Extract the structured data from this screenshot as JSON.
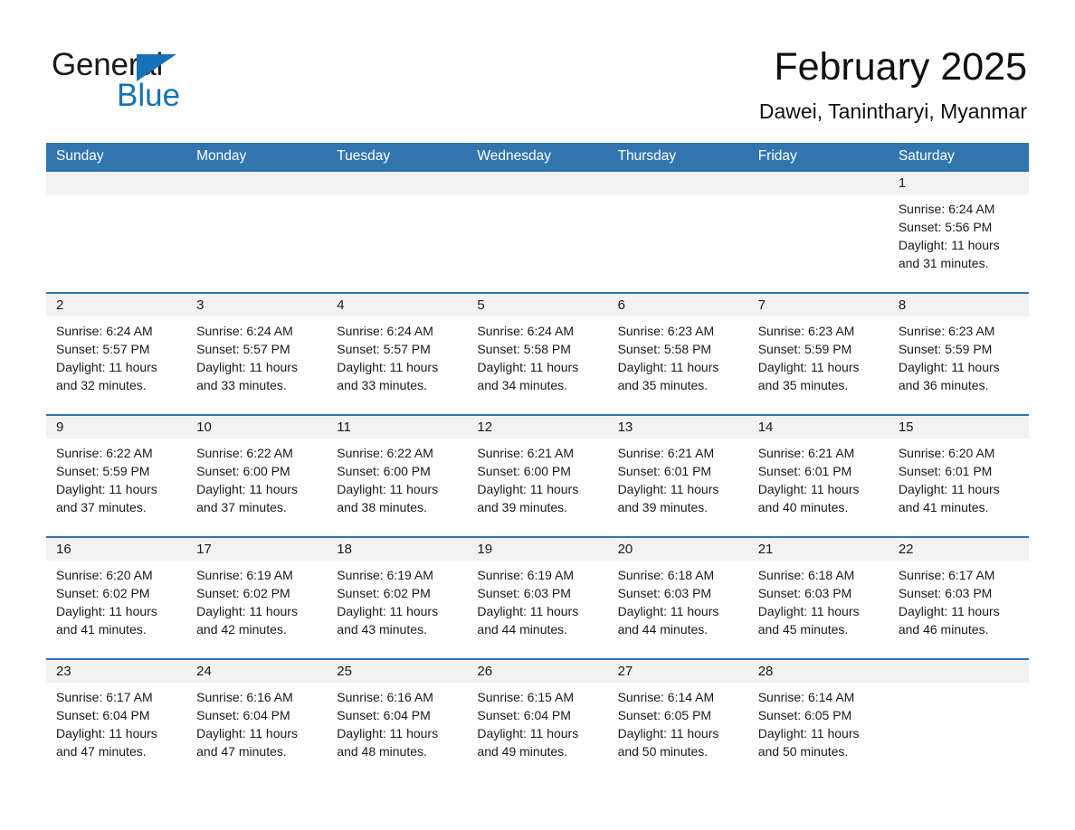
{
  "brand": {
    "name_part1": "General",
    "name_part2": "Blue",
    "triangle_color": "#1672b8"
  },
  "header": {
    "title": "February 2025",
    "subtitle": "Dawei, Tanintharyi, Myanmar",
    "accent_color": "#3175b0"
  },
  "weekday_headers": [
    "Sunday",
    "Monday",
    "Tuesday",
    "Wednesday",
    "Thursday",
    "Friday",
    "Saturday"
  ],
  "weeks": [
    [
      {
        "day": "",
        "sunrise": "",
        "sunset": "",
        "daylight": ""
      },
      {
        "day": "",
        "sunrise": "",
        "sunset": "",
        "daylight": ""
      },
      {
        "day": "",
        "sunrise": "",
        "sunset": "",
        "daylight": ""
      },
      {
        "day": "",
        "sunrise": "",
        "sunset": "",
        "daylight": ""
      },
      {
        "day": "",
        "sunrise": "",
        "sunset": "",
        "daylight": ""
      },
      {
        "day": "",
        "sunrise": "",
        "sunset": "",
        "daylight": ""
      },
      {
        "day": "1",
        "sunrise": "Sunrise: 6:24 AM",
        "sunset": "Sunset: 5:56 PM",
        "daylight": "Daylight: 11 hours and 31 minutes."
      }
    ],
    [
      {
        "day": "2",
        "sunrise": "Sunrise: 6:24 AM",
        "sunset": "Sunset: 5:57 PM",
        "daylight": "Daylight: 11 hours and 32 minutes."
      },
      {
        "day": "3",
        "sunrise": "Sunrise: 6:24 AM",
        "sunset": "Sunset: 5:57 PM",
        "daylight": "Daylight: 11 hours and 33 minutes."
      },
      {
        "day": "4",
        "sunrise": "Sunrise: 6:24 AM",
        "sunset": "Sunset: 5:57 PM",
        "daylight": "Daylight: 11 hours and 33 minutes."
      },
      {
        "day": "5",
        "sunrise": "Sunrise: 6:24 AM",
        "sunset": "Sunset: 5:58 PM",
        "daylight": "Daylight: 11 hours and 34 minutes."
      },
      {
        "day": "6",
        "sunrise": "Sunrise: 6:23 AM",
        "sunset": "Sunset: 5:58 PM",
        "daylight": "Daylight: 11 hours and 35 minutes."
      },
      {
        "day": "7",
        "sunrise": "Sunrise: 6:23 AM",
        "sunset": "Sunset: 5:59 PM",
        "daylight": "Daylight: 11 hours and 35 minutes."
      },
      {
        "day": "8",
        "sunrise": "Sunrise: 6:23 AM",
        "sunset": "Sunset: 5:59 PM",
        "daylight": "Daylight: 11 hours and 36 minutes."
      }
    ],
    [
      {
        "day": "9",
        "sunrise": "Sunrise: 6:22 AM",
        "sunset": "Sunset: 5:59 PM",
        "daylight": "Daylight: 11 hours and 37 minutes."
      },
      {
        "day": "10",
        "sunrise": "Sunrise: 6:22 AM",
        "sunset": "Sunset: 6:00 PM",
        "daylight": "Daylight: 11 hours and 37 minutes."
      },
      {
        "day": "11",
        "sunrise": "Sunrise: 6:22 AM",
        "sunset": "Sunset: 6:00 PM",
        "daylight": "Daylight: 11 hours and 38 minutes."
      },
      {
        "day": "12",
        "sunrise": "Sunrise: 6:21 AM",
        "sunset": "Sunset: 6:00 PM",
        "daylight": "Daylight: 11 hours and 39 minutes."
      },
      {
        "day": "13",
        "sunrise": "Sunrise: 6:21 AM",
        "sunset": "Sunset: 6:01 PM",
        "daylight": "Daylight: 11 hours and 39 minutes."
      },
      {
        "day": "14",
        "sunrise": "Sunrise: 6:21 AM",
        "sunset": "Sunset: 6:01 PM",
        "daylight": "Daylight: 11 hours and 40 minutes."
      },
      {
        "day": "15",
        "sunrise": "Sunrise: 6:20 AM",
        "sunset": "Sunset: 6:01 PM",
        "daylight": "Daylight: 11 hours and 41 minutes."
      }
    ],
    [
      {
        "day": "16",
        "sunrise": "Sunrise: 6:20 AM",
        "sunset": "Sunset: 6:02 PM",
        "daylight": "Daylight: 11 hours and 41 minutes."
      },
      {
        "day": "17",
        "sunrise": "Sunrise: 6:19 AM",
        "sunset": "Sunset: 6:02 PM",
        "daylight": "Daylight: 11 hours and 42 minutes."
      },
      {
        "day": "18",
        "sunrise": "Sunrise: 6:19 AM",
        "sunset": "Sunset: 6:02 PM",
        "daylight": "Daylight: 11 hours and 43 minutes."
      },
      {
        "day": "19",
        "sunrise": "Sunrise: 6:19 AM",
        "sunset": "Sunset: 6:03 PM",
        "daylight": "Daylight: 11 hours and 44 minutes."
      },
      {
        "day": "20",
        "sunrise": "Sunrise: 6:18 AM",
        "sunset": "Sunset: 6:03 PM",
        "daylight": "Daylight: 11 hours and 44 minutes."
      },
      {
        "day": "21",
        "sunrise": "Sunrise: 6:18 AM",
        "sunset": "Sunset: 6:03 PM",
        "daylight": "Daylight: 11 hours and 45 minutes."
      },
      {
        "day": "22",
        "sunrise": "Sunrise: 6:17 AM",
        "sunset": "Sunset: 6:03 PM",
        "daylight": "Daylight: 11 hours and 46 minutes."
      }
    ],
    [
      {
        "day": "23",
        "sunrise": "Sunrise: 6:17 AM",
        "sunset": "Sunset: 6:04 PM",
        "daylight": "Daylight: 11 hours and 47 minutes."
      },
      {
        "day": "24",
        "sunrise": "Sunrise: 6:16 AM",
        "sunset": "Sunset: 6:04 PM",
        "daylight": "Daylight: 11 hours and 47 minutes."
      },
      {
        "day": "25",
        "sunrise": "Sunrise: 6:16 AM",
        "sunset": "Sunset: 6:04 PM",
        "daylight": "Daylight: 11 hours and 48 minutes."
      },
      {
        "day": "26",
        "sunrise": "Sunrise: 6:15 AM",
        "sunset": "Sunset: 6:04 PM",
        "daylight": "Daylight: 11 hours and 49 minutes."
      },
      {
        "day": "27",
        "sunrise": "Sunrise: 6:14 AM",
        "sunset": "Sunset: 6:05 PM",
        "daylight": "Daylight: 11 hours and 50 minutes."
      },
      {
        "day": "28",
        "sunrise": "Sunrise: 6:14 AM",
        "sunset": "Sunset: 6:05 PM",
        "daylight": "Daylight: 11 hours and 50 minutes."
      },
      {
        "day": "",
        "sunrise": "",
        "sunset": "",
        "daylight": ""
      }
    ]
  ]
}
